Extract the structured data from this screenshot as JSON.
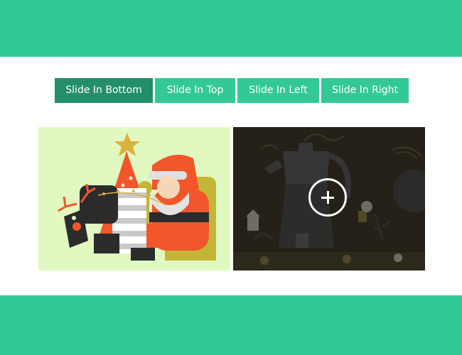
{
  "tabs": [
    {
      "label": "Slide In Bottom",
      "active": true
    },
    {
      "label": "Slide In Top",
      "active": false
    },
    {
      "label": "Slide In Left",
      "active": false
    },
    {
      "label": "Slide In Right",
      "active": false
    }
  ],
  "gallery": {
    "items": [
      {
        "image": "santa-reindeer-illustration"
      },
      {
        "image": "coffee-moka-pot-illustration",
        "overlay_icon": "plus-icon"
      }
    ]
  },
  "colors": {
    "accent": "#33c994",
    "accent_dark": "#238f68",
    "card1_bg": "#e1f8c1",
    "card2_bg": "#2a2619"
  }
}
